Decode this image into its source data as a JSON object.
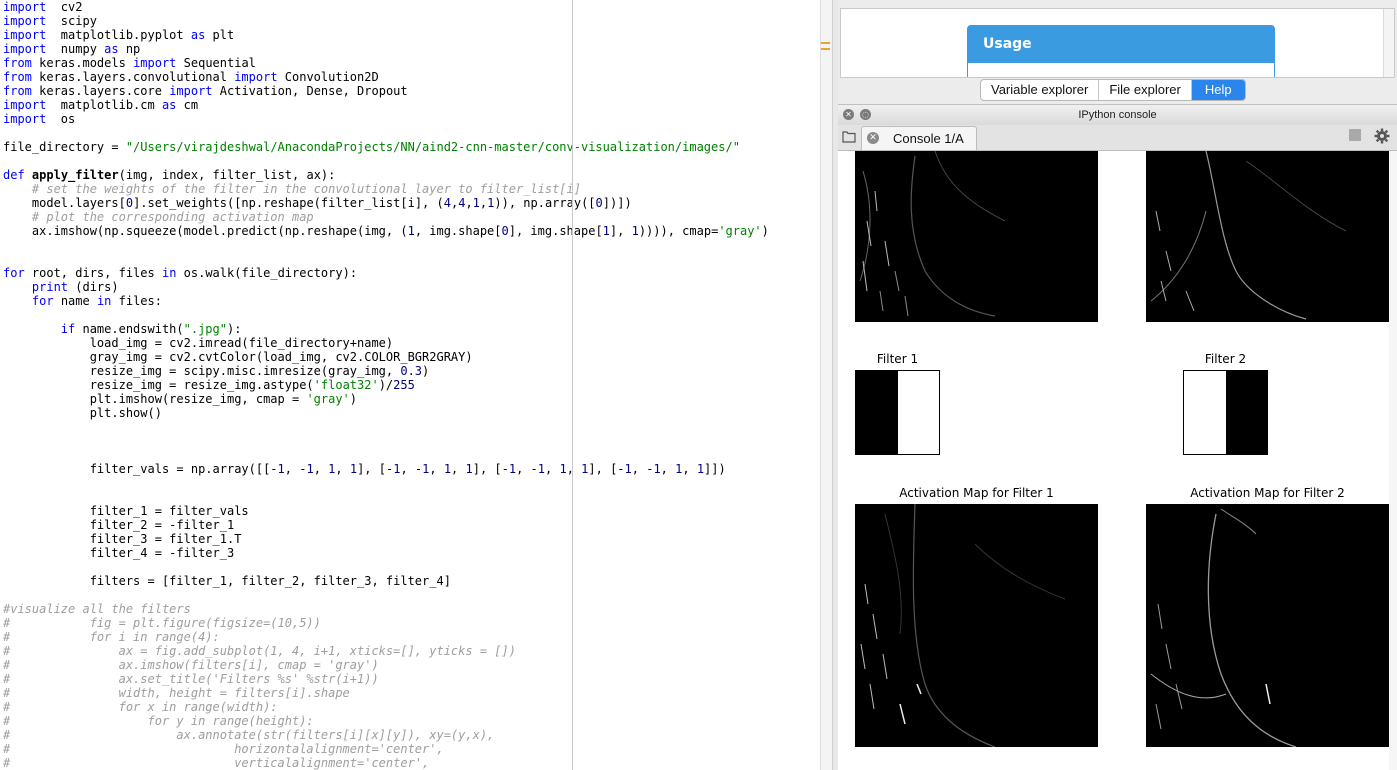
{
  "editor": {
    "lines": [
      [
        [
          "kw",
          "import"
        ],
        [
          "",
          "  cv2"
        ]
      ],
      [
        [
          "kw",
          "import"
        ],
        [
          "",
          "  scipy"
        ]
      ],
      [
        [
          "kw",
          "import"
        ],
        [
          "",
          "  matplotlib.pyplot "
        ],
        [
          "kw",
          "as"
        ],
        [
          "",
          " plt"
        ]
      ],
      [
        [
          "kw",
          "import"
        ],
        [
          "",
          "  numpy "
        ],
        [
          "kw",
          "as"
        ],
        [
          "",
          " np"
        ]
      ],
      [
        [
          "kw",
          "from"
        ],
        [
          "",
          " keras.models "
        ],
        [
          "kw",
          "import"
        ],
        [
          "",
          " Sequential"
        ]
      ],
      [
        [
          "kw",
          "from"
        ],
        [
          "",
          " keras.layers.convolutional "
        ],
        [
          "kw",
          "import"
        ],
        [
          "",
          " Convolution2D"
        ]
      ],
      [
        [
          "kw",
          "from"
        ],
        [
          "",
          " keras.layers.core "
        ],
        [
          "kw",
          "import"
        ],
        [
          "",
          " Activation, Dense, Dropout"
        ]
      ],
      [
        [
          "kw",
          "import"
        ],
        [
          "",
          "  matplotlib.cm "
        ],
        [
          "kw",
          "as"
        ],
        [
          "",
          " cm"
        ]
      ],
      [
        [
          "kw",
          "import"
        ],
        [
          "",
          "  os"
        ]
      ],
      [],
      [
        [
          "",
          "file_directory = "
        ],
        [
          "str",
          "\"/Users/virajdeshwal/AnacondaProjects/NN/aind2-cnn-master/conv-visualization/images/\""
        ]
      ],
      [],
      [
        [
          "kw",
          "def"
        ],
        [
          "",
          " "
        ],
        [
          "fn",
          "apply_filter"
        ],
        [
          "",
          "(img, index, filter_list, ax):"
        ]
      ],
      [
        [
          "cm",
          "    # set the weights of the filter in the convolutional layer to filter_list[i]"
        ]
      ],
      [
        [
          "",
          "    model.layers["
        ],
        [
          "num",
          "0"
        ],
        [
          "",
          "].set_weights([np.reshape(filter_list[i], ("
        ],
        [
          "num",
          "4"
        ],
        [
          "",
          ","
        ],
        [
          "num",
          "4"
        ],
        [
          "",
          ","
        ],
        [
          "num",
          "1"
        ],
        [
          "",
          ","
        ],
        [
          "num",
          "1"
        ],
        [
          "",
          ")), np.array(["
        ],
        [
          "num",
          "0"
        ],
        [
          "",
          "])])"
        ]
      ],
      [
        [
          "cm",
          "    # plot the corresponding activation map"
        ]
      ],
      [
        [
          "",
          "    ax.imshow(np.squeeze(model.predict(np.reshape(img, ("
        ],
        [
          "num",
          "1"
        ],
        [
          "",
          ", img.shape["
        ],
        [
          "num",
          "0"
        ],
        [
          "",
          "], img.shape["
        ],
        [
          "num",
          "1"
        ],
        [
          "",
          "], "
        ],
        [
          "num",
          "1"
        ],
        [
          "",
          ")))), cmap="
        ],
        [
          "str",
          "'gray'"
        ],
        [
          "",
          ")"
        ]
      ],
      [],
      [],
      [
        [
          "kw",
          "for"
        ],
        [
          "",
          " root, dirs, files "
        ],
        [
          "kw",
          "in"
        ],
        [
          "",
          " os.walk(file_directory):"
        ]
      ],
      [
        [
          "",
          "    "
        ],
        [
          "kw",
          "print"
        ],
        [
          "",
          " (dirs)"
        ]
      ],
      [
        [
          "",
          "    "
        ],
        [
          "kw",
          "for"
        ],
        [
          "",
          " name "
        ],
        [
          "kw",
          "in"
        ],
        [
          "",
          " files:"
        ]
      ],
      [],
      [
        [
          "",
          "        "
        ],
        [
          "kw",
          "if"
        ],
        [
          "",
          " name.endswith("
        ],
        [
          "str",
          "\".jpg\""
        ],
        [
          "",
          "):"
        ]
      ],
      [
        [
          "",
          "            load_img = cv2.imread(file_directory+name)"
        ]
      ],
      [
        [
          "",
          "            gray_img = cv2.cvtColor(load_img, cv2.COLOR_BGR2GRAY)"
        ]
      ],
      [
        [
          "",
          "            resize_img = scipy.misc.imresize(gray_img, "
        ],
        [
          "num",
          "0.3"
        ],
        [
          "",
          ")"
        ]
      ],
      [
        [
          "",
          "            resize_img = resize_img.astype("
        ],
        [
          "str",
          "'float32'"
        ],
        [
          "",
          ")/"
        ],
        [
          "num",
          "255"
        ]
      ],
      [
        [
          "",
          "            plt.imshow(resize_img, cmap = "
        ],
        [
          "str",
          "'gray'"
        ],
        [
          "",
          ")"
        ]
      ],
      [
        [
          "",
          "            plt.show()"
        ]
      ],
      [],
      [],
      [],
      [
        [
          "",
          "            filter_vals = np.array([[-"
        ],
        [
          "num",
          "1"
        ],
        [
          "",
          ", -"
        ],
        [
          "num",
          "1"
        ],
        [
          "",
          ", "
        ],
        [
          "num",
          "1"
        ],
        [
          "",
          ", "
        ],
        [
          "num",
          "1"
        ],
        [
          "",
          "], [-"
        ],
        [
          "num",
          "1"
        ],
        [
          "",
          ", -"
        ],
        [
          "num",
          "1"
        ],
        [
          "",
          ", "
        ],
        [
          "num",
          "1"
        ],
        [
          "",
          ", "
        ],
        [
          "num",
          "1"
        ],
        [
          "",
          "], [-"
        ],
        [
          "num",
          "1"
        ],
        [
          "",
          ", -"
        ],
        [
          "num",
          "1"
        ],
        [
          "",
          ", "
        ],
        [
          "num",
          "1"
        ],
        [
          "",
          ", "
        ],
        [
          "num",
          "1"
        ],
        [
          "",
          "], [-"
        ],
        [
          "num",
          "1"
        ],
        [
          "",
          ", -"
        ],
        [
          "num",
          "1"
        ],
        [
          "",
          ", "
        ],
        [
          "num",
          "1"
        ],
        [
          "",
          ", "
        ],
        [
          "num",
          "1"
        ],
        [
          "",
          "]])"
        ]
      ],
      [],
      [],
      [
        [
          "",
          "            filter_1 = filter_vals"
        ]
      ],
      [
        [
          "",
          "            filter_2 = -filter_1"
        ]
      ],
      [
        [
          "",
          "            filter_3 = filter_1.T"
        ]
      ],
      [
        [
          "",
          "            filter_4 = -filter_3"
        ]
      ],
      [],
      [
        [
          "",
          "            filters = [filter_1, filter_2, filter_3, filter_4]"
        ]
      ],
      [],
      [
        [
          "cm",
          "#visualize all the filters"
        ]
      ],
      [
        [
          "cm",
          "#           fig = plt.figure(figsize=(10,5))"
        ]
      ],
      [
        [
          "cm",
          "#           for i in range(4):"
        ]
      ],
      [
        [
          "cm",
          "#               ax = fig.add_subplot(1, 4, i+1, xticks=[], yticks = [])"
        ]
      ],
      [
        [
          "cm",
          "#               ax.imshow(filters[i], cmap = 'gray')"
        ]
      ],
      [
        [
          "cm",
          "#               ax.set_title('Filters %s' %str(i+1))"
        ]
      ],
      [
        [
          "cm",
          "#               width, height = filters[i].shape"
        ]
      ],
      [
        [
          "cm",
          "#               for x in range(width):"
        ]
      ],
      [
        [
          "cm",
          "#                   for y in range(height):"
        ]
      ],
      [
        [
          "cm",
          "#                       ax.annotate(str(filters[i][x][y]), xy=(y,x),"
        ]
      ],
      [
        [
          "cm",
          "#                               horizontalalignment='center',"
        ]
      ],
      [
        [
          "cm",
          "#                               verticalalignment='center',"
        ]
      ]
    ]
  },
  "help": {
    "header": "Usage"
  },
  "tabs": [
    {
      "label": "Variable explorer",
      "active": false
    },
    {
      "label": "File explorer",
      "active": false
    },
    {
      "label": "Help",
      "active": true
    }
  ],
  "console": {
    "pane_title": "IPython console",
    "tab_label": "Console 1/A",
    "plots": {
      "filter_1_title": "Filter 1",
      "filter_2_title": "Filter 2",
      "act_1_title": "Activation Map for Filter 1",
      "act_2_title": "Activation Map for Filter 2"
    }
  },
  "colors": {
    "accent": "#2b86ec",
    "usage_header": "#3b9be0",
    "keyword": "#0000ff",
    "string": "#008000",
    "comment": "#9e9e9e"
  }
}
